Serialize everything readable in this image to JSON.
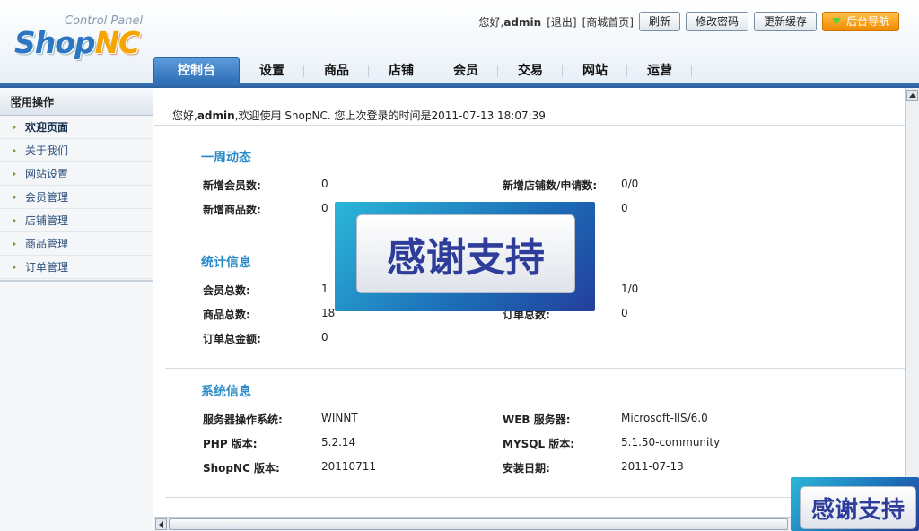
{
  "header": {
    "logo_subtitle": "Control Panel",
    "logo_brand_part1": "Shop",
    "logo_brand_part2": "NC",
    "greeting_prefix": "您好,",
    "username": "admin",
    "logout_link": "[退出]",
    "mall_home_link": "[商城首页]",
    "refresh_button": "刷新",
    "change_password_button": "修改密码",
    "update_cache_button": "更新缓存",
    "backend_nav_button": "后台导航"
  },
  "nav": {
    "tabs": [
      "控制台",
      "设置",
      "商品",
      "店铺",
      "会员",
      "交易",
      "网站",
      "运营"
    ],
    "active_index": 0
  },
  "sidebar": {
    "title": "常用操作",
    "items": [
      "欢迎页面",
      "关于我们",
      "网站设置",
      "会员管理",
      "店铺管理",
      "商品管理",
      "订单管理"
    ],
    "active_index": 0
  },
  "welcome": {
    "prefix": "您好,",
    "username": "admin",
    "text": ",欢迎使用 ShopNC. 您上次登录的时间是2011-07-13 18:07:39"
  },
  "weekly": {
    "title": "一周动态",
    "new_members_label": "新增会员数:",
    "new_members_value": "0",
    "new_stores_label": "新增店铺数/申请数:",
    "new_stores_value": "0/0",
    "new_goods_label": "新增商品数:",
    "new_goods_value": "0",
    "new_orders_value": "0"
  },
  "stats": {
    "title": "统计信息",
    "member_total_label": "会员总数:",
    "member_total_value": "1",
    "store_total_value": "1/0",
    "goods_total_label": "商品总数:",
    "goods_total_value": "18",
    "order_total_label": "订单总数:",
    "order_total_value": "0",
    "order_amount_label": "订单总金额:",
    "order_amount_value": "0"
  },
  "system": {
    "title": "系统信息",
    "os_label": "服务器操作系统:",
    "os_value": "WINNT",
    "web_server_label": "WEB 服务器:",
    "web_server_value": "Microsoft-IIS/6.0",
    "php_label": "PHP 版本:",
    "php_value": "5.2.14",
    "mysql_label": "MYSQL 版本:",
    "mysql_value": "5.1.50-community",
    "shopnc_label": "ShopNC 版本:",
    "shopnc_value": "20110711",
    "install_date_label": "安装日期:",
    "install_date_value": "2011-07-13"
  },
  "watermark": {
    "text": "感谢支持"
  }
}
